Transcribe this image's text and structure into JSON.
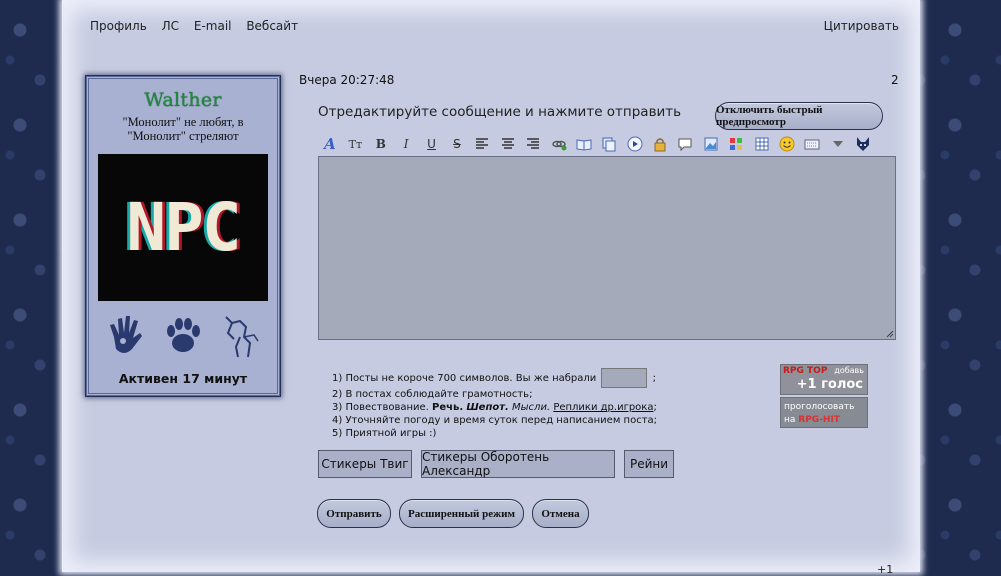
{
  "colors": {
    "frame": "#c7cce2",
    "accent_name": "#1d8a3c",
    "editor_bg": "#a5aabb"
  },
  "header": {
    "links": [
      "Профиль",
      "ЛС",
      "E-mail",
      "Вебсайт"
    ],
    "quote": "Цитировать"
  },
  "profile": {
    "name": "Walther",
    "quote": "\"Монолит\" не любят, в \"Монолит\" стреляют",
    "avatar_text": "NPC",
    "badges": [
      "hand-icon",
      "paw-icon",
      "wolf-icon"
    ],
    "status": "Активен 17 минут"
  },
  "post": {
    "time": "Вчера 20:27:48",
    "number": "2"
  },
  "editor": {
    "hint": "Отредактируйте сообщение и нажмите отправить",
    "preview_toggle": "Отключить быстрый предпросмотр",
    "toolbar": [
      "font-icon",
      "size-icon",
      "bold-icon",
      "italic-icon",
      "underline-icon",
      "strike-icon",
      "align-left-icon",
      "align-center-icon",
      "align-right-icon",
      "link-icon",
      "book-icon",
      "copy-icon",
      "play-icon",
      "lock-icon",
      "speech-icon",
      "image-icon",
      "color-icon",
      "table-icon",
      "smile-icon",
      "keyboard-icon",
      "more-icon",
      "wolf-logo-icon"
    ],
    "text_value": ""
  },
  "rules": {
    "line1_a": "1) Посты не короче 700 символов. Вы же набрали",
    "line1_b": ";",
    "line2": "2) В постах соблюдайте грамотность;",
    "line3_a": "3) Повествование. ",
    "line3_speech": "Речь.",
    "line3_whisper": "Шепот.",
    "line3_thought": "Мысли.",
    "line3_link": "Реплики др.игрока",
    "line3_end": ";",
    "line4": "4) Уточняйте погоду и время суток перед написанием поста;",
    "line5": "5) Приятной игры :)"
  },
  "banners": {
    "top_title": "RPG TOP",
    "top_add": "добавь",
    "top_vote": "+1 голос",
    "hit_text": "проголосовать",
    "hit_on": "на",
    "hit_name": "RPG-HIT"
  },
  "stickers": [
    "Стикеры Твиг",
    "Стикеры Оборотень Александр",
    "Рейни"
  ],
  "actions": {
    "send": "Отправить",
    "advanced": "Расширенный режим",
    "cancel": "Отмена"
  },
  "footer": {
    "plus": "+1"
  }
}
